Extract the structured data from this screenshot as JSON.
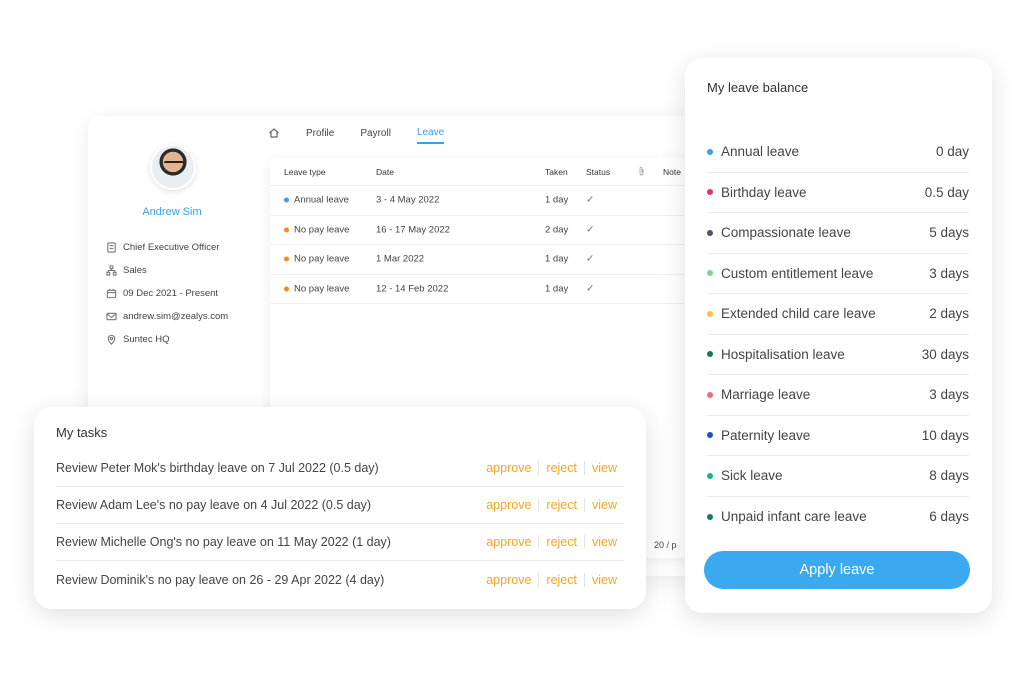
{
  "profile": {
    "name": "Andrew Sim",
    "info": [
      {
        "icon": "id-card-icon",
        "text": "Chief Executive Officer"
      },
      {
        "icon": "org-chart-icon",
        "text": "Sales"
      },
      {
        "icon": "calendar-icon",
        "text": "09 Dec 2021 - Present"
      },
      {
        "icon": "mail-icon",
        "text": "andrew.sim@zealys.com"
      },
      {
        "icon": "location-icon",
        "text": "Suntec HQ"
      }
    ]
  },
  "tabs": [
    "Profile",
    "Payroll",
    "Leave"
  ],
  "active_tab": "Leave",
  "leave_table": {
    "headers": {
      "type": "Leave type",
      "date": "Date",
      "taken": "Taken",
      "status": "Status",
      "note": "Note"
    },
    "rows": [
      {
        "type": "Annual leave",
        "color": "#3aa0e6",
        "date": "3 - 4 May 2022",
        "taken": "1 day",
        "status": "✓"
      },
      {
        "type": "No pay leave",
        "color": "#f5891f",
        "date": "16 - 17 May 2022",
        "taken": "2 day",
        "status": "✓"
      },
      {
        "type": "No pay leave",
        "color": "#f5891f",
        "date": "1 Mar 2022",
        "taken": "1 day",
        "status": "✓"
      },
      {
        "type": "No pay leave",
        "color": "#f5891f",
        "date": "12 - 14 Feb 2022",
        "taken": "1 day",
        "status": "✓"
      }
    ],
    "pager": "20 / p"
  },
  "tasks": {
    "title": "My tasks",
    "items": [
      {
        "text": "Review Peter Mok's birthday leave on 7 Jul 2022 (0.5 day)"
      },
      {
        "text": "Review Adam Lee's no pay leave on 4 Jul 2022 (0.5 day)"
      },
      {
        "text": "Review Michelle Ong's no pay leave on 11 May 2022 (1 day)"
      },
      {
        "text": "Review Dominik's no pay leave on 26 - 29 Apr 2022 (4 day)"
      }
    ],
    "actions": {
      "approve": "approve",
      "reject": "reject",
      "view": "view"
    }
  },
  "balance": {
    "title": "My leave balance",
    "items": [
      {
        "name": "Annual leave",
        "value": "0 day",
        "color": "#3aa0e6"
      },
      {
        "name": "Birthday leave",
        "value": "0.5 day",
        "color": "#e0336e"
      },
      {
        "name": "Compassionate leave",
        "value": "5 days",
        "color": "#4a5563"
      },
      {
        "name": "Custom entitlement leave",
        "value": "3 days",
        "color": "#7dd3a0"
      },
      {
        "name": "Extended child care leave",
        "value": "2 days",
        "color": "#f5c242"
      },
      {
        "name": "Hospitalisation leave",
        "value": "30 days",
        "color": "#127a4a"
      },
      {
        "name": "Marriage leave",
        "value": "3 days",
        "color": "#ee6b7a"
      },
      {
        "name": "Paternity leave",
        "value": "10 days",
        "color": "#1f4fc7"
      },
      {
        "name": "Sick leave",
        "value": "8 days",
        "color": "#1bb37a"
      },
      {
        "name": "Unpaid infant care leave",
        "value": "6 days",
        "color": "#10804e"
      }
    ],
    "apply_label": "Apply leave"
  }
}
